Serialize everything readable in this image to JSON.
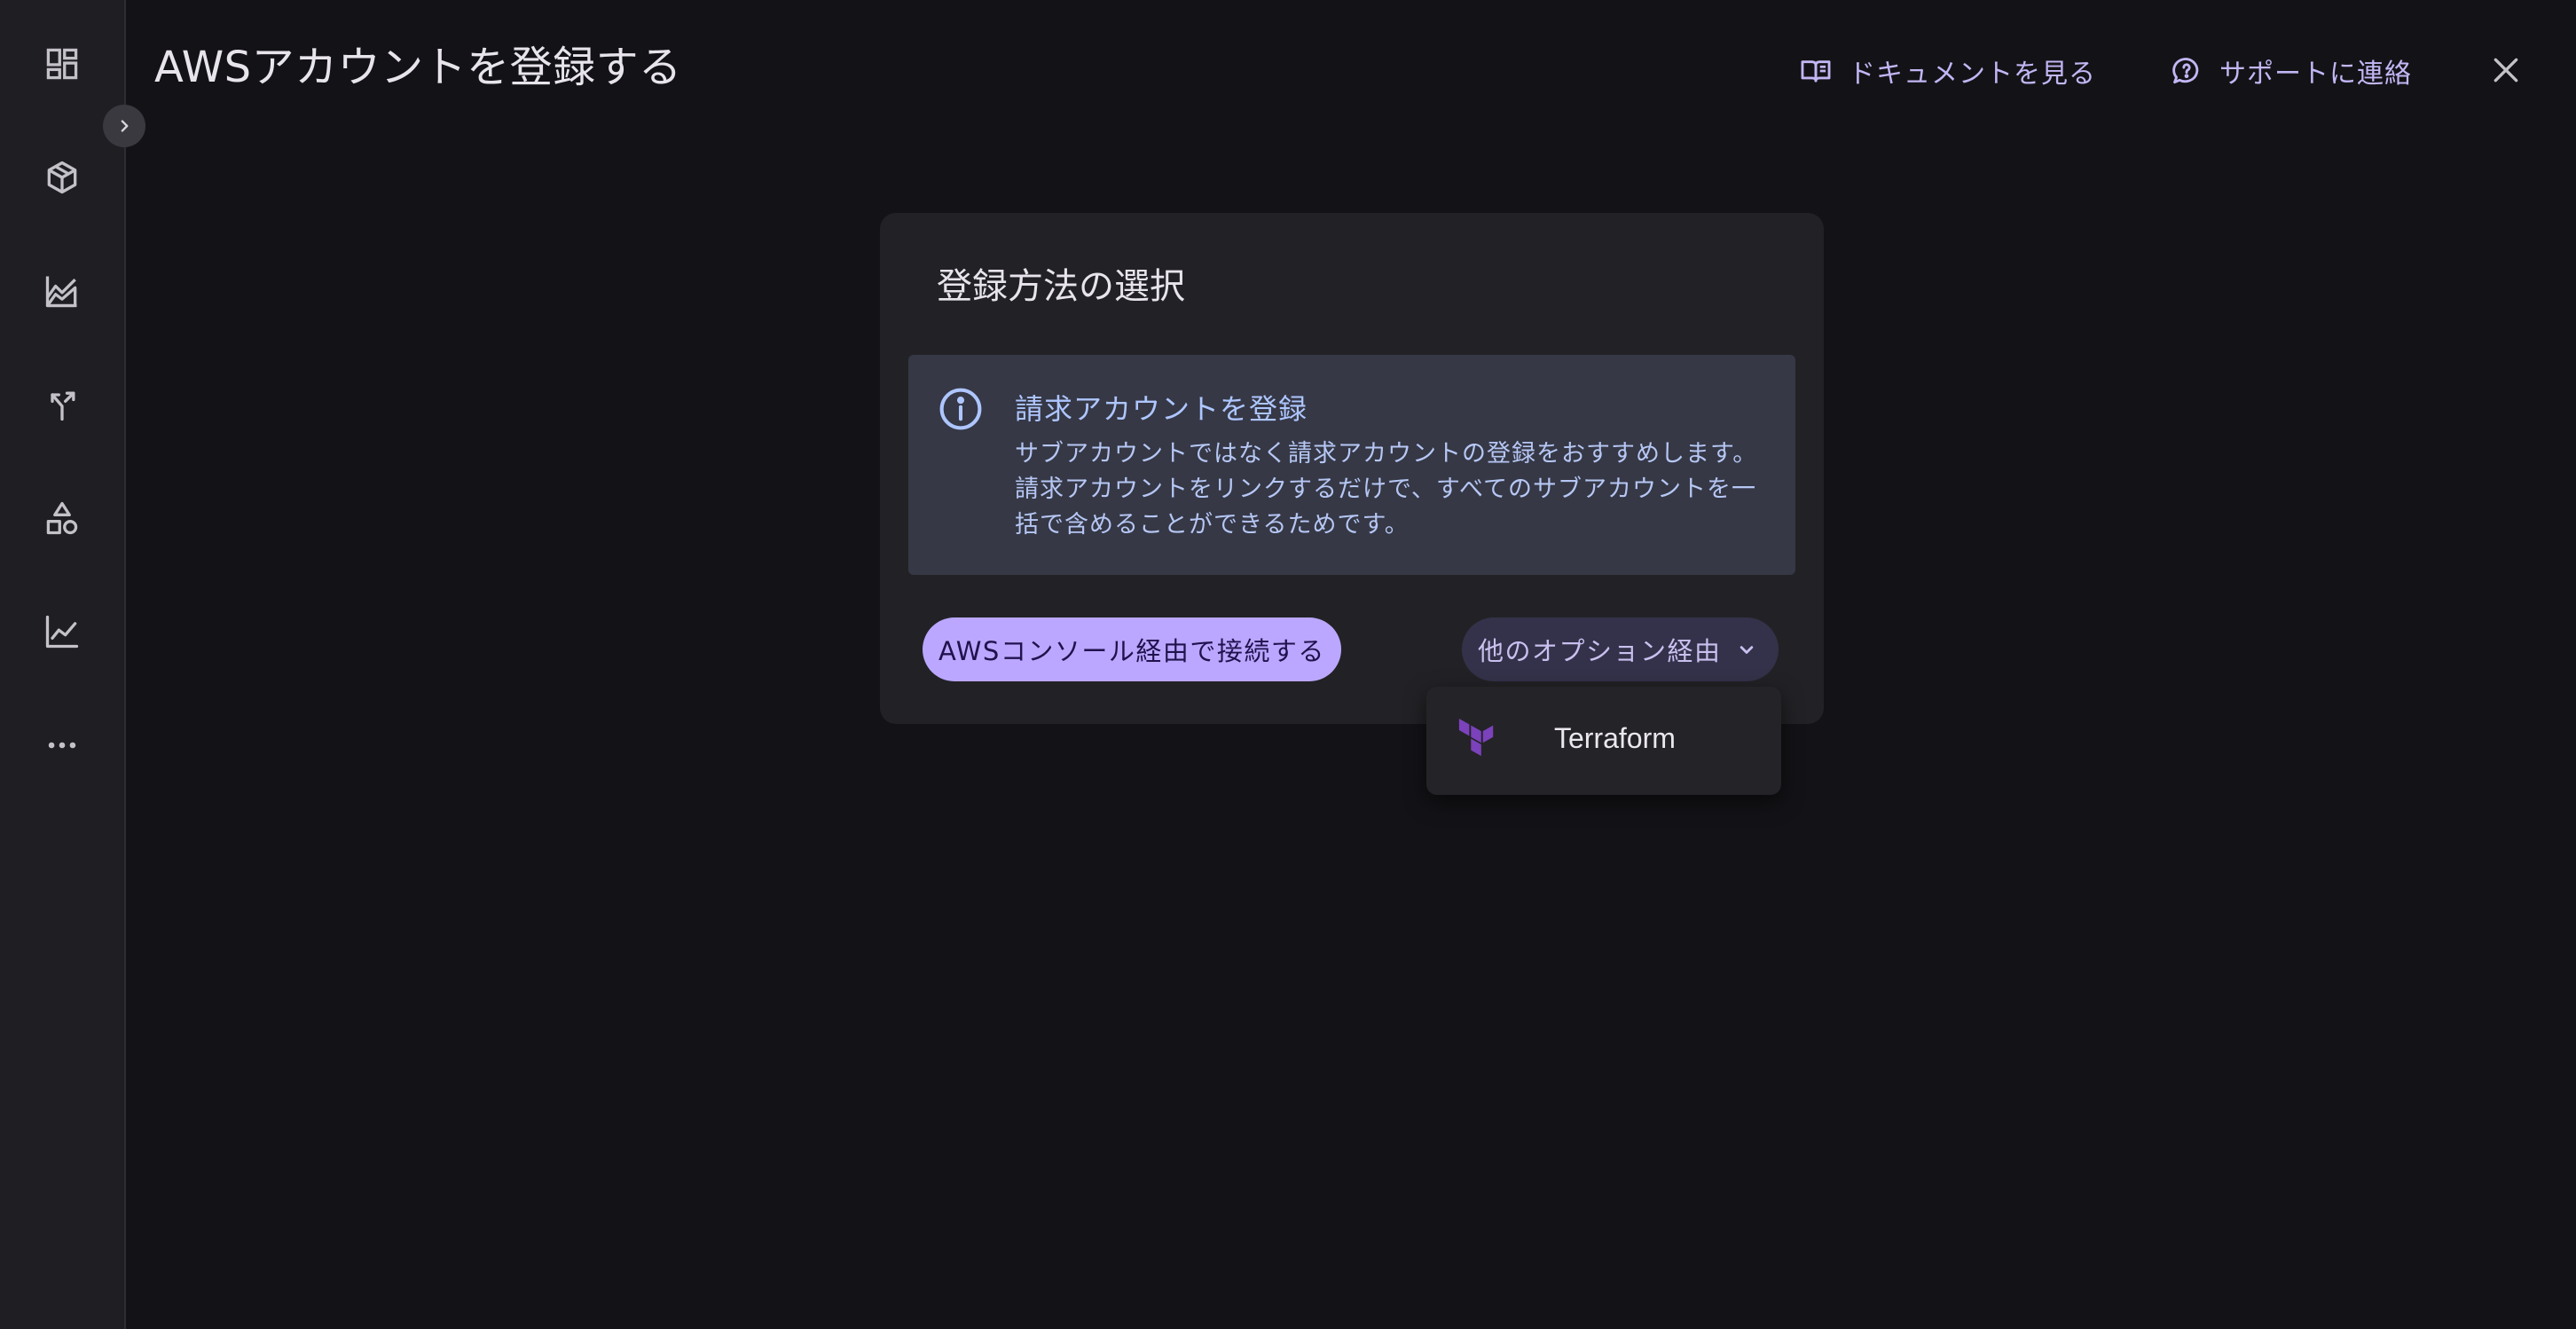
{
  "header": {
    "title": "AWSアカウントを登録する",
    "docs_link": "ドキュメントを見る",
    "support_link": "サポートに連絡"
  },
  "sidebar": {
    "items": [
      {
        "icon": "dashboard-icon"
      },
      {
        "icon": "cube-icon"
      },
      {
        "icon": "area-chart-icon"
      },
      {
        "icon": "split-arrow-icon"
      },
      {
        "icon": "shapes-icon"
      },
      {
        "icon": "line-chart-icon"
      },
      {
        "icon": "more-icon"
      }
    ]
  },
  "card": {
    "title": "登録方法の選択",
    "info": {
      "title": "請求アカウントを登録",
      "body": "サブアカウントではなく請求アカウントの登録をおすすめします。請求アカウントをリンクするだけで、すべてのサブアカウントを一括で含めることができるためです。"
    },
    "primary_button": "AWSコンソール経由で接続する",
    "options_button": "他のオプション経由"
  },
  "menu": {
    "items": [
      {
        "label": "Terraform",
        "icon": "terraform-icon"
      }
    ]
  },
  "colors": {
    "background": "#131317",
    "sidebar": "#1f1f23",
    "card": "#222226",
    "info_box": "#363846",
    "accent": "#bba7ff",
    "link": "#c3b6f4",
    "info_text": "#aec6ff",
    "terraform": "#7b42bc"
  }
}
